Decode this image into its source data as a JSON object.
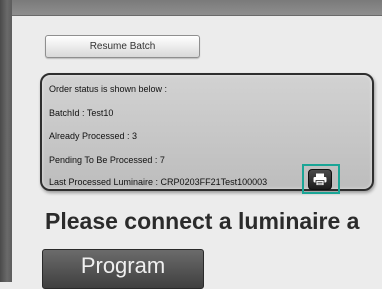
{
  "toolbar": {
    "resume_label": "Resume Batch"
  },
  "order_status": {
    "heading": "Order status is shown below :",
    "batch_id": "BatchId :  Test10",
    "already_processed": "Already Processed :  3",
    "pending": "Pending To Be Processed :  7",
    "last_processed": "Last Processed Luminaire :  CRP0203FF21Test100003"
  },
  "print": {
    "icon": "printer-icon"
  },
  "message": {
    "connect": "Please connect a luminaire a"
  },
  "actions": {
    "program_label": "Program"
  },
  "colors": {
    "highlight": "#1aa596",
    "panel_border": "#2e2e2e"
  }
}
